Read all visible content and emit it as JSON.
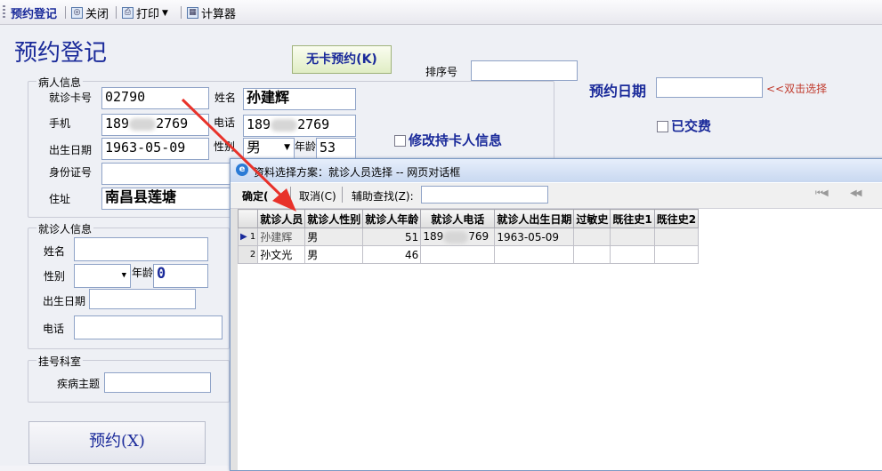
{
  "toolbar": {
    "items": [
      "预约登记",
      "关闭",
      "打印",
      "计算器"
    ]
  },
  "form": {
    "title": "预约登记",
    "no_card_button": "无卡预约(K)",
    "sequence_label": "排序号",
    "sequence_value": "",
    "appt_date_label": "预约日期",
    "appt_date_value": "",
    "dblclick_hint": "<<双击选择",
    "paid_label": "已交费",
    "modify_label": "修改持卡人信息",
    "patient_group": "病人信息",
    "card_label": "就诊卡号",
    "card_value": "02790",
    "name_label": "姓名",
    "name_value": "孙建辉",
    "mobile_label": "手机",
    "mobile_prefix": "189",
    "mobile_suffix": "2769",
    "phone_label": "电话",
    "phone_prefix": "189",
    "phone_suffix": "2769",
    "dob_label": "出生日期",
    "dob_value": "1963-05-09",
    "gender_label": "性别",
    "gender_value": "男",
    "age_label": "年龄",
    "age_value": "53",
    "id_label": "身份证号",
    "id_value": "",
    "address_label": "住址",
    "address_value": "南昌县莲塘",
    "visitor_group": "就诊人信息",
    "v_name_label": "姓名",
    "v_gender_label": "性别",
    "v_age_label": "年龄",
    "v_age_value": "0",
    "v_dob_label": "出生日期",
    "v_phone_label": "电话",
    "dept_group": "挂号科室",
    "disease_label": "疾病主题",
    "submit_button": "预约(X)"
  },
  "dialog": {
    "title": "资料选择方案：就诊人员选择 -- 网页对话框",
    "ok": "确定(",
    "cancel": "取消(C)",
    "search_label": "辅助查找(Z):",
    "search_value": "",
    "columns": [
      "就诊人员",
      "就诊人性别",
      "就诊人年龄",
      "就诊人电话",
      "就诊人出生日期",
      "过敏史",
      "既往史1",
      "既往史2"
    ],
    "rows": [
      {
        "no": "1",
        "name": "孙建辉",
        "gender": "男",
        "age": "51",
        "phone_prefix": "189",
        "phone_suffix": "769",
        "dob": "1963-05-09"
      },
      {
        "no": "2",
        "name": "孙文光",
        "gender": "男",
        "age": "46",
        "phone_prefix": "",
        "phone_suffix": "",
        "dob": ""
      }
    ]
  },
  "colors": {
    "accent": "#1a2a9a",
    "arrow": "#e8322a",
    "hint": "#c0392b"
  }
}
